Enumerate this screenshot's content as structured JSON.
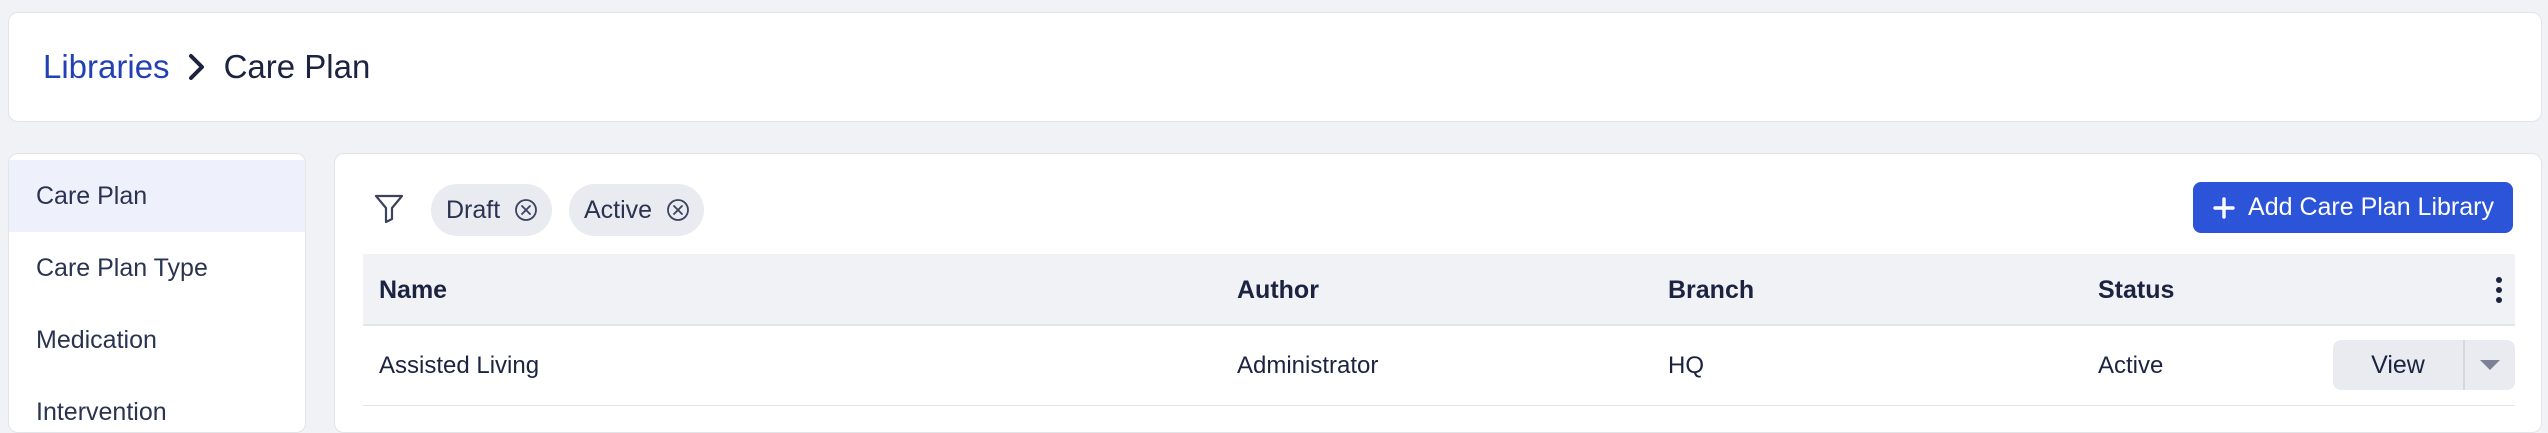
{
  "breadcrumb": {
    "parent": "Libraries",
    "current": "Care Plan"
  },
  "sidebar": {
    "items": [
      {
        "label": "Care Plan",
        "active": true
      },
      {
        "label": "Care Plan Type",
        "active": false
      },
      {
        "label": "Medication",
        "active": false
      },
      {
        "label": "Intervention",
        "active": false
      }
    ]
  },
  "filters": {
    "icon": "filter-icon",
    "chips": [
      {
        "label": "Draft"
      },
      {
        "label": "Active"
      }
    ]
  },
  "toolbar": {
    "add_label": "Add Care Plan Library"
  },
  "table": {
    "columns": [
      "Name",
      "Author",
      "Branch",
      "Status"
    ],
    "rows": [
      {
        "name": "Assisted Living",
        "author": "Administrator",
        "branch": "HQ",
        "status": "Active",
        "action_label": "View"
      }
    ]
  },
  "colors": {
    "accent": "#2c54d9",
    "link": "#2341b5",
    "text": "#1b2340",
    "background": "#f1f2f6"
  }
}
